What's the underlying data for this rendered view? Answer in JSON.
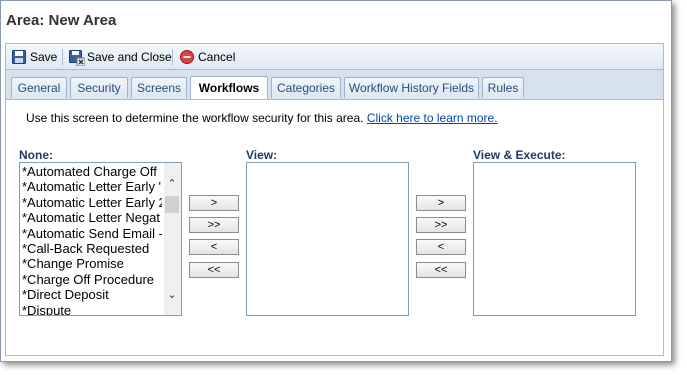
{
  "page": {
    "title": "Area: New Area"
  },
  "toolbar": {
    "save_label": "Save",
    "save_close_label": "Save and Close",
    "cancel_label": "Cancel"
  },
  "tabs": [
    {
      "label": "General"
    },
    {
      "label": "Security"
    },
    {
      "label": "Screens"
    },
    {
      "label": "Workflows"
    },
    {
      "label": "Categories"
    },
    {
      "label": "Workflow History Fields"
    },
    {
      "label": "Rules"
    }
  ],
  "active_tab": "Workflows",
  "description": {
    "text": "Use this screen to determine the workflow security for this area.",
    "link": "Click here to learn more."
  },
  "lists": {
    "none_label": "None:",
    "view_label": "View:",
    "view_execute_label": "View & Execute:",
    "none_items": [
      "*Automated Charge Off",
      "*Automatic Letter Early '",
      "*Automatic Letter Early 2",
      "*Automatic Letter Negat",
      "*Automatic Send Email -",
      "*Call-Back Requested",
      "*Change Promise",
      "*Charge Off Procedure",
      "*Direct Deposit",
      "*Dispute"
    ]
  },
  "move_buttons": {
    "move_right": ">",
    "move_all_right": ">>",
    "move_left": "<",
    "move_all_left": "<<"
  },
  "icons": {
    "save": "floppy-disk-icon",
    "save_close": "save-and-close-icon",
    "cancel": "cancel-icon"
  }
}
